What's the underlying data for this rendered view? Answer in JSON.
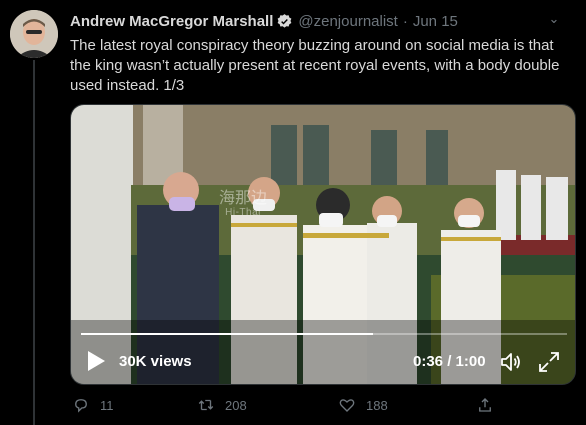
{
  "tweet": {
    "author_name": "Andrew MacGregor Marshall",
    "handle": "@zenjournalist",
    "separator": "·",
    "date": "Jun 15",
    "text": "The latest royal conspiracy theory buzzing around on social media is that the king wasn’t actually present at recent royal events, with a body double used instead. 1/3",
    "verified_icon": "verified-badge-icon",
    "accent_color": "#1d9bf0"
  },
  "video": {
    "watermark_main": "海那边",
    "watermark_sub": "Hi-Thai",
    "views": "30K views",
    "time": "0:36 / 1:00",
    "progress_fraction": 0.6,
    "icons": [
      "play-icon",
      "volume-icon",
      "fullscreen-icon"
    ]
  },
  "actions": {
    "reply_count": "11",
    "retweet_count": "208",
    "like_count": "188",
    "icons": [
      "reply-icon",
      "retweet-icon",
      "like-icon",
      "share-icon"
    ]
  }
}
